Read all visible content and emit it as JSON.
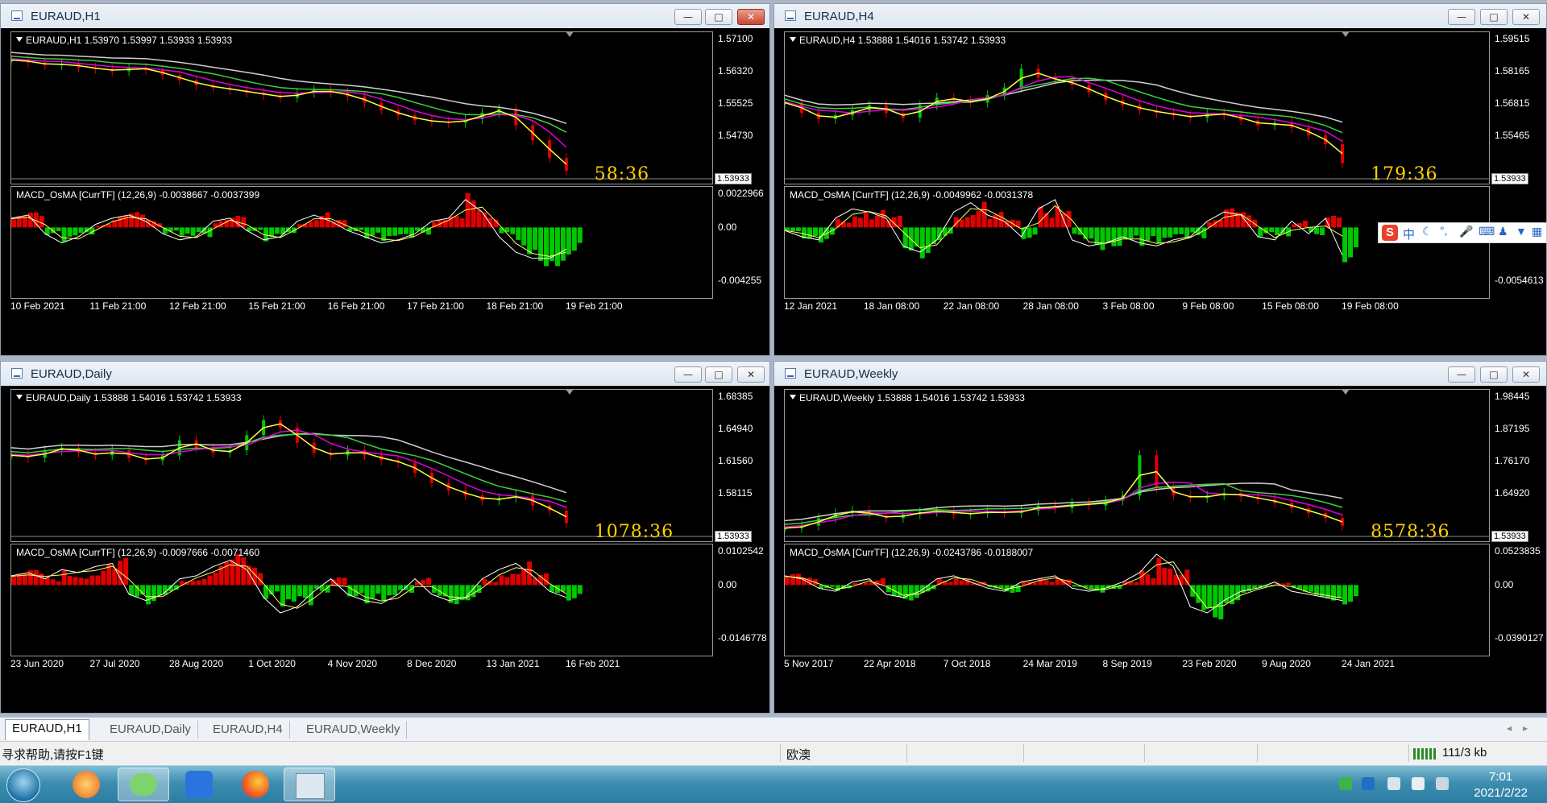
{
  "windows": [
    {
      "id": "h1",
      "title": "EURAUD,H1",
      "close_active": true,
      "ohlc_label": "EURAUD,H1  1.53970 1.53997 1.53933 1.53933",
      "price_ticks": [
        "1.57100",
        "1.56320",
        "1.55525",
        "1.54730"
      ],
      "price_tag": "1.53933",
      "timer": "58:36",
      "macd_label": "MACD_OsMA [CurrTF] (12,26,9) -0.0038667 -0.0037399",
      "macd_ticks": [
        "0.0022966",
        "0.00",
        "-0.004255"
      ],
      "time_ticks": [
        "10 Feb 2021",
        "11 Feb 21:00",
        "12 Feb 21:00",
        "15 Feb 21:00",
        "16 Feb 21:00",
        "17 Feb 21:00",
        "18 Feb 21:00",
        "19 Feb 21:00"
      ]
    },
    {
      "id": "h4",
      "title": "EURAUD,H4",
      "close_active": false,
      "ohlc_label": "EURAUD,H4  1.53888 1.54016 1.53742 1.53933",
      "price_ticks": [
        "1.59515",
        "1.58165",
        "1.56815",
        "1.55465"
      ],
      "price_tag": "1.53933",
      "timer": "179:36",
      "macd_label": "MACD_OsMA [CurrTF] (12,26,9) -0.0049962 -0.0031378",
      "macd_ticks": [
        "",
        "0.00",
        "-0.0054613"
      ],
      "time_ticks": [
        "12 Jan 2021",
        "18 Jan 08:00",
        "22 Jan 08:00",
        "28 Jan 08:00",
        "3 Feb 08:00",
        "9 Feb 08:00",
        "15 Feb 08:00",
        "19 Feb 08:00"
      ]
    },
    {
      "id": "daily",
      "title": "EURAUD,Daily",
      "close_active": false,
      "ohlc_label": "EURAUD,Daily  1.53888 1.54016 1.53742 1.53933",
      "price_ticks": [
        "1.68385",
        "1.64940",
        "1.61560",
        "1.58115"
      ],
      "price_tag": "1.53933",
      "timer": "1078:36",
      "macd_label": "MACD_OsMA [CurrTF] (12,26,9) -0.0097666 -0.0071460",
      "macd_ticks": [
        "0.0102542",
        "0.00",
        "-0.0146778"
      ],
      "time_ticks": [
        "23 Jun 2020",
        "27 Jul 2020",
        "28 Aug 2020",
        "1 Oct 2020",
        "4 Nov 2020",
        "8 Dec 2020",
        "13 Jan 2021",
        "16 Feb 2021"
      ]
    },
    {
      "id": "weekly",
      "title": "EURAUD,Weekly",
      "close_active": false,
      "ohlc_label": "EURAUD,Weekly  1.53888 1.54016 1.53742 1.53933",
      "price_ticks": [
        "1.98445",
        "1.87195",
        "1.76170",
        "1.64920"
      ],
      "price_tag": "1.53933",
      "timer": "8578:36",
      "macd_label": "MACD_OsMA [CurrTF] (12,26,9) -0.0243786 -0.0188007",
      "macd_ticks": [
        "0.0523835",
        "0.00",
        "-0.0390127"
      ],
      "time_ticks": [
        "5 Nov 2017",
        "22 Apr 2018",
        "7 Oct 2018",
        "24 Mar 2019",
        "8 Sep 2019",
        "23 Feb 2020",
        "9 Aug 2020",
        "24 Jan 2021"
      ]
    }
  ],
  "tabs": [
    "EURAUD,H1",
    "EURAUD,Daily",
    "EURAUD,H4",
    "EURAUD,Weekly"
  ],
  "status": {
    "help_text": "寻求帮助,请按F1键",
    "profile": "欧澳",
    "traffic": "111/3 kb"
  },
  "ime": {
    "badge": "S",
    "lang": "中"
  },
  "clock": {
    "time": "7:01",
    "date": "2021/2/22"
  },
  "colors": {
    "bull": "#00c800",
    "bear": "#e00000",
    "ma_white": "#cfcfcf",
    "ma_green": "#3ecf3e",
    "ma_magenta": "#e000e0",
    "ma_yellow": "#ffff40",
    "timer": "#ffd200"
  },
  "series": {
    "h1": [
      0.92,
      0.9,
      0.88,
      0.89,
      0.86,
      0.85,
      0.83,
      0.86,
      0.84,
      0.8,
      0.76,
      0.72,
      0.7,
      0.68,
      0.66,
      0.64,
      0.62,
      0.66,
      0.68,
      0.66,
      0.63,
      0.58,
      0.52,
      0.48,
      0.44,
      0.43,
      0.42,
      0.45,
      0.5,
      0.53,
      0.4,
      0.28,
      0.14,
      0.04
    ],
    "h4": [
      0.58,
      0.5,
      0.45,
      0.48,
      0.52,
      0.56,
      0.5,
      0.46,
      0.56,
      0.62,
      0.6,
      0.58,
      0.64,
      0.7,
      0.85,
      0.78,
      0.76,
      0.72,
      0.66,
      0.6,
      0.56,
      0.52,
      0.5,
      0.48,
      0.46,
      0.5,
      0.48,
      0.44,
      0.4,
      0.42,
      0.38,
      0.32,
      0.25,
      0.1
    ],
    "daily": [
      0.62,
      0.6,
      0.66,
      0.68,
      0.64,
      0.62,
      0.66,
      0.6,
      0.58,
      0.62,
      0.74,
      0.68,
      0.64,
      0.66,
      0.78,
      0.9,
      0.84,
      0.72,
      0.64,
      0.62,
      0.66,
      0.62,
      0.58,
      0.56,
      0.48,
      0.4,
      0.34,
      0.3,
      0.26,
      0.28,
      0.3,
      0.22,
      0.18,
      0.08
    ],
    "weekly": [
      0.04,
      0.06,
      0.12,
      0.16,
      0.18,
      0.14,
      0.12,
      0.15,
      0.17,
      0.18,
      0.15,
      0.16,
      0.17,
      0.16,
      0.18,
      0.22,
      0.2,
      0.24,
      0.22,
      0.26,
      0.3,
      0.62,
      0.36,
      0.3,
      0.28,
      0.3,
      0.32,
      0.29,
      0.27,
      0.24,
      0.2,
      0.16,
      0.12,
      0.06
    ]
  },
  "macd": {
    "h1": [
      0.3,
      0.4,
      -0.2,
      -0.5,
      -0.3,
      0.1,
      0.3,
      0.4,
      0.2,
      -0.2,
      -0.4,
      -0.3,
      0.2,
      0.3,
      -0.1,
      -0.4,
      -0.3,
      0.2,
      0.4,
      0.2,
      -0.1,
      -0.3,
      -0.5,
      -0.4,
      -0.2,
      0.2,
      0.3,
      0.9,
      0.5,
      -0.3,
      -0.8,
      -1.0,
      -1.0,
      -0.7
    ],
    "h4": [
      -0.1,
      -0.3,
      -0.4,
      0.3,
      0.6,
      0.5,
      0.3,
      -0.6,
      -0.8,
      -0.4,
      0.5,
      0.8,
      0.4,
      0.2,
      -0.3,
      0.6,
      0.9,
      -0.4,
      -0.6,
      -0.5,
      -0.3,
      -0.5,
      -0.6,
      -0.4,
      -0.3,
      0.2,
      0.5,
      0.4,
      -0.3,
      -0.4,
      0.2,
      -0.2,
      0.3,
      -0.9
    ],
    "daily": [
      0.3,
      0.4,
      0.2,
      0.5,
      0.4,
      0.6,
      0.7,
      -0.3,
      -0.5,
      -0.3,
      0.2,
      0.3,
      0.6,
      0.8,
      0.5,
      -0.4,
      -0.9,
      -0.7,
      -0.2,
      0.2,
      -0.3,
      -0.5,
      -0.6,
      -0.3,
      0.2,
      -0.3,
      -0.5,
      -0.4,
      0.2,
      0.5,
      0.7,
      0.3,
      -0.2,
      -0.4
    ],
    "weekly": [
      0.3,
      0.2,
      -0.1,
      -0.2,
      0.1,
      0.2,
      -0.3,
      -0.4,
      -0.2,
      0.2,
      0.3,
      0.1,
      -0.1,
      -0.2,
      0.1,
      0.2,
      0.3,
      -0.1,
      -0.2,
      -0.1,
      0.1,
      0.4,
      1.0,
      0.6,
      -0.7,
      -0.9,
      -0.5,
      -0.2,
      -0.1,
      0.1,
      -0.2,
      -0.3,
      -0.4,
      -0.5
    ]
  }
}
